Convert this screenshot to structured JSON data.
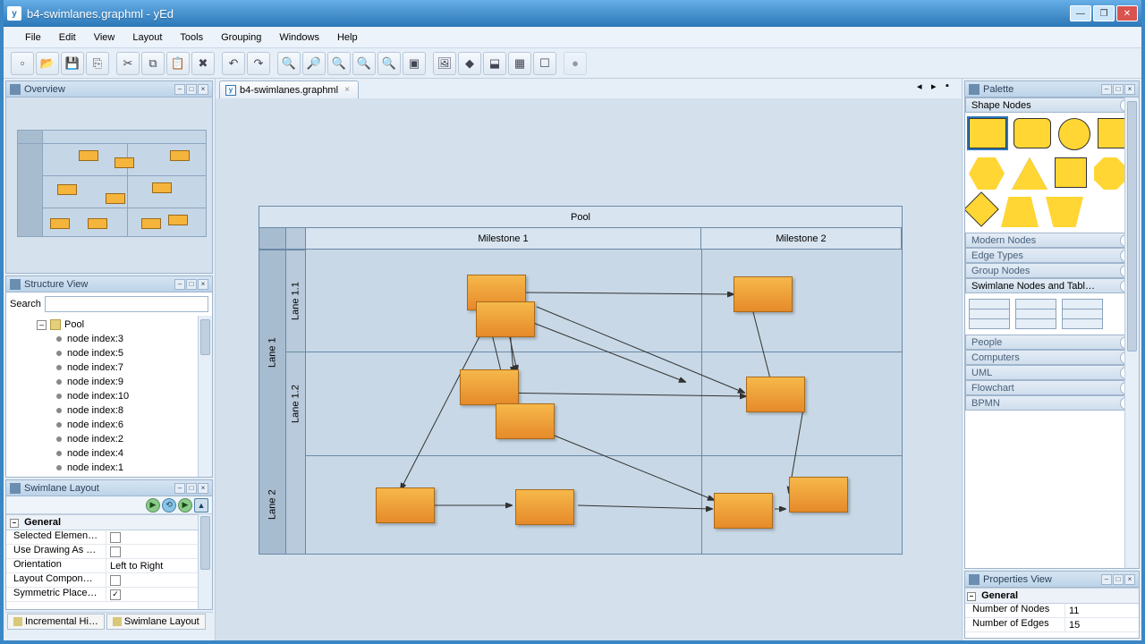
{
  "title": "b4-swimlanes.graphml - yEd",
  "menus": [
    "File",
    "Edit",
    "View",
    "Layout",
    "Tools",
    "Grouping",
    "Windows",
    "Help"
  ],
  "toolbar_icons": [
    "new",
    "open",
    "save",
    "export",
    "",
    "cut",
    "copy",
    "paste",
    "delete",
    "",
    "undo",
    "redo",
    "",
    "zoom-in",
    "zoom-out",
    "zoom-100",
    "zoom-sel",
    "zoom-fit",
    "fit-content",
    "",
    "img",
    "rel",
    "hier",
    "grid",
    "layout",
    "",
    "print"
  ],
  "tab_name": "b4-swimlanes.graphml",
  "panels": {
    "overview": "Overview",
    "structure": "Structure View",
    "swimlane": "Swimlane Layout",
    "palette": "Palette",
    "properties": "Properties View"
  },
  "search_label": "Search",
  "tree": {
    "root": "Pool",
    "children": [
      "node index:3",
      "node index:5",
      "node index:7",
      "node index:9",
      "node index:10",
      "node index:8",
      "node index:6",
      "node index:2",
      "node index:4",
      "node index:1"
    ]
  },
  "swimlane_props": {
    "section": "General",
    "rows": [
      {
        "label": "Selected Elemen…",
        "type": "check",
        "val": false
      },
      {
        "label": "Use Drawing As …",
        "type": "check",
        "val": false
      },
      {
        "label": "Orientation",
        "type": "text",
        "val": "Left to Right"
      },
      {
        "label": "Layout Compon…",
        "type": "check",
        "val": false
      },
      {
        "label": "Symmetric Place…",
        "type": "check",
        "val": true
      }
    ]
  },
  "bottom_tabs": [
    "Incremental Hi…",
    "Swimlane Layout"
  ],
  "pool": {
    "title": "Pool",
    "columns": [
      "Milestone 1",
      "Milestone 2"
    ],
    "lane1": "Lane 1",
    "lane2": "Lane 2",
    "sub1": "Lane 1.1",
    "sub2": "Lane 1.2"
  },
  "palette_sections": {
    "shape": "Shape Nodes",
    "modern": "Modern Nodes",
    "edge": "Edge Types",
    "group": "Group Nodes",
    "swim": "Swimlane Nodes and Tabl…",
    "people": "People",
    "computers": "Computers",
    "uml": "UML",
    "flowchart": "Flowchart",
    "bpmn": "BPMN"
  },
  "properties": {
    "section": "General",
    "rows": [
      {
        "label": "Number of Nodes",
        "val": "11"
      },
      {
        "label": "Number of Edges",
        "val": "15"
      }
    ]
  }
}
